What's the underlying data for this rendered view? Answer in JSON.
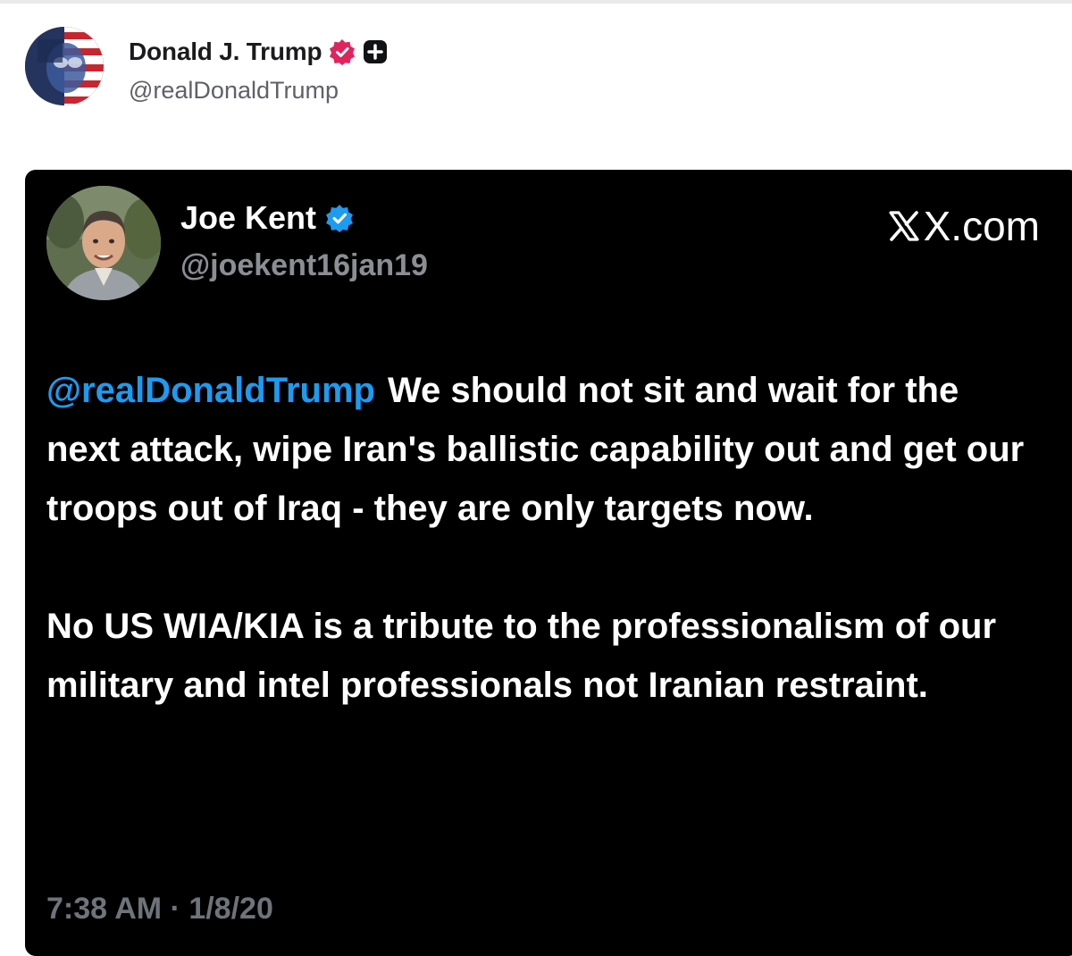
{
  "post": {
    "author_name": "Donald J. Trump",
    "author_handle": "@realDonaldTrump",
    "verified_badge_color": "#e0245e",
    "icons": [
      "avatar",
      "verified-badge-icon",
      "plus-icon"
    ]
  },
  "embed": {
    "author_name": "Joe Kent",
    "author_handle": "@joekent16jan19",
    "verified_badge_color": "#1d9bf0",
    "source": "X.com",
    "mention": "@realDonaldTrump",
    "paragraph1": "We should not sit and wait for the next attack, wipe Iran's ballistic capability out and get our troops out of Iraq - they are only targets now.",
    "paragraph2": "No US WIA/KIA is a tribute to the professionalism of our military and intel professionals not Iranian restraint.",
    "timestamp": "7:38 AM · 1/8/20",
    "colors": {
      "card_background": "#000000",
      "mention": "#1d9bf0",
      "text": "#ffffff",
      "muted": "#8b8e93"
    }
  }
}
